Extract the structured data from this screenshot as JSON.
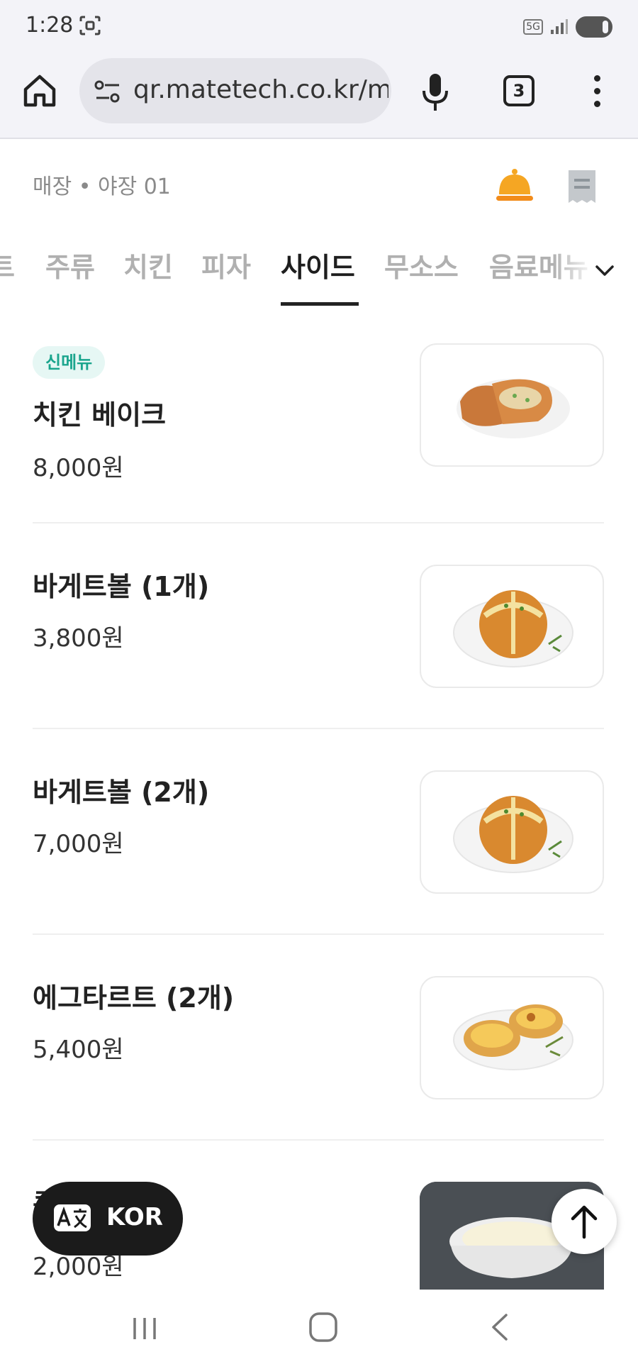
{
  "status_bar": {
    "time": "1:28",
    "network": "5G"
  },
  "browser": {
    "url": "qr.matetech.co.kr/me",
    "tab_count": "3"
  },
  "header": {
    "store_info": "매장 • 야장 01",
    "bell_color": "#f5a623"
  },
  "categories": {
    "items": [
      {
        "label": "트"
      },
      {
        "label": "주류"
      },
      {
        "label": "치킨"
      },
      {
        "label": "피자"
      },
      {
        "label": "사이드"
      },
      {
        "label": "무소스"
      },
      {
        "label": "음료메뉴"
      }
    ],
    "active": "사이드"
  },
  "menu": {
    "items": [
      {
        "badge": "신메뉴",
        "name": "치킨 베이크",
        "price": "8,000원",
        "image": "chicken-bake-photo"
      },
      {
        "badge": "",
        "name": "바게트볼 (1개)",
        "price": "3,800원",
        "image": "baguette-ball-photo"
      },
      {
        "badge": "",
        "name": "바게트볼 (2개)",
        "price": "7,000원",
        "image": "baguette-ball-photo"
      },
      {
        "badge": "",
        "name": "에그타르트 (2개)",
        "price": "5,400원",
        "image": "egg-tart-photo"
      },
      {
        "badge": "",
        "name": "콘",
        "price": "2,000원",
        "image": "corn-cup-photo"
      }
    ]
  },
  "language_button": {
    "label": "KOR"
  },
  "colors": {
    "accent_badge_text": "#1aa58d",
    "accent_badge_bg": "#e6f7f4",
    "active_category": "#1e1e1e",
    "inactive_category": "#b0b0b0"
  }
}
